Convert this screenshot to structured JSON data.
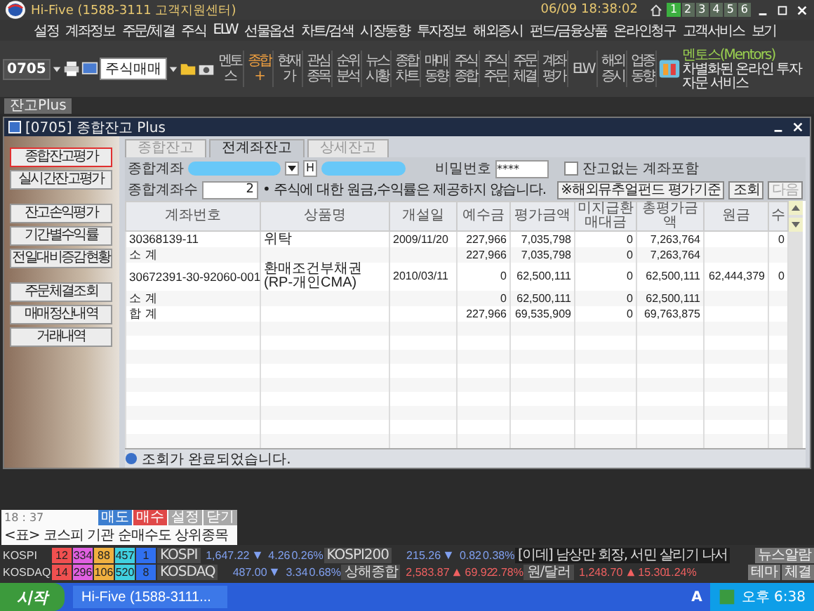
{
  "app": {
    "title": "Hi-Five (1588-3111 고객지원센터)",
    "datetime": "06/09 18:38:02",
    "screens": [
      {
        "label": "1",
        "selected": true
      },
      {
        "label": "2",
        "selected": false
      },
      {
        "label": "3",
        "selected": false
      },
      {
        "label": "4",
        "selected": false
      },
      {
        "label": "5",
        "selected": false
      },
      {
        "label": "6",
        "selected": false
      }
    ]
  },
  "menu": [
    "설정",
    "계좌정보",
    "주문/체결",
    "주식",
    "ELW",
    "선물옵션",
    "차트/검색",
    "시장동향",
    "투자정보",
    "해외증시",
    "펀드/금융상품",
    "온라인청구",
    "고객서비스",
    "보기"
  ],
  "toolbar": {
    "screen_no": "0705",
    "combo": "주식매매",
    "buttons": [
      {
        "label": "멘토스",
        "highlight": false
      },
      {
        "label": "종합+",
        "highlight": true
      },
      {
        "label": "현재가",
        "highlight": false
      },
      {
        "label": "관심종목",
        "highlight": false
      },
      {
        "label": "순위분석",
        "highlight": false
      },
      {
        "label": "뉴스시황",
        "highlight": false
      },
      {
        "label": "종합차트",
        "highlight": false
      },
      {
        "label": "매매동향",
        "highlight": false
      },
      {
        "label": "주식종합",
        "highlight": false
      },
      {
        "label": "주식주문",
        "highlight": false
      },
      {
        "label": "주문체결",
        "highlight": false
      },
      {
        "label": "계좌평가",
        "highlight": false
      },
      {
        "label": "ELW",
        "highlight": false
      },
      {
        "label": "해외증시",
        "highlight": false
      },
      {
        "label": "업종동향",
        "highlight": false
      }
    ],
    "promo": {
      "title": "멘토스(Mentors)",
      "subtitle": "차별화된 온라인 투자자문 서비스"
    }
  },
  "doc_tab": "잔고Plus",
  "window": {
    "title": "[0705] 종합잔고 Plus",
    "side_groups": [
      [
        {
          "label": "종합잔고평가",
          "selected": true
        },
        {
          "label": "실시간잔고평가",
          "selected": false
        }
      ],
      [
        {
          "label": "잔고손익평가",
          "selected": false
        },
        {
          "label": "기간별수익률",
          "selected": false
        },
        {
          "label": "전일대비증감현황",
          "selected": false
        }
      ],
      [
        {
          "label": "주문체결조회",
          "selected": false
        },
        {
          "label": "매매정산내역",
          "selected": false
        },
        {
          "label": "거래내역",
          "selected": false
        }
      ]
    ],
    "tabs": [
      {
        "label": "종합잔고",
        "selected": false
      },
      {
        "label": "전계좌잔고",
        "selected": true
      },
      {
        "label": "상세잔고",
        "selected": false
      }
    ],
    "account_label": "종합계좌",
    "account_mid": "H",
    "password_label": "비밀번호",
    "password": "****",
    "include_empty": {
      "label": "잔고없는 계좌포함",
      "checked": false
    },
    "count_label": "종합계좌수",
    "count": "2",
    "notice": "• 주식에 대한 원금,수익률은 제공하지 않습니다.",
    "fund_button": "※해외뮤추얼펀드 평가기준",
    "query_button": "조회",
    "next_button": {
      "label": "다음",
      "disabled": true
    },
    "table": {
      "columns": [
        "계좌번호",
        "상품명",
        "개설일",
        "예수금",
        "평가금액",
        "미지급환매대금",
        "총평가금액",
        "원금",
        "수"
      ],
      "rows": [
        [
          "30368139-11",
          "위탁",
          "2009/11/20",
          "227,966",
          "7,035,798",
          "0",
          "7,263,764",
          "",
          "0"
        ],
        [
          "소    계",
          "",
          "",
          "227,966",
          "7,035,798",
          "0",
          "7,263,764",
          "",
          ""
        ],
        [
          "30672391-30-92060-001",
          "환매조건부채권(RP-개인CMA)",
          "2010/03/11",
          "0",
          "62,500,111",
          "0",
          "62,500,111",
          "62,444,379",
          "0"
        ],
        [
          "소    계",
          "",
          "",
          "0",
          "62,500,111",
          "0",
          "62,500,111",
          "",
          ""
        ],
        [
          "합    계",
          "",
          "",
          "227,966",
          "69,535,909",
          "0",
          "69,763,875",
          "",
          ""
        ]
      ]
    },
    "status": "조회가 완료되었습니다."
  },
  "alert": {
    "time": "18 : 37",
    "buttons": [
      {
        "label": "매도",
        "color": "#3d7fd0"
      },
      {
        "label": "매수",
        "color": "#e04848"
      },
      {
        "label": "설정",
        "color": "#a8a8a8"
      },
      {
        "label": "닫기",
        "color": "#a8a8a8"
      }
    ],
    "text": "<표> 코스피 기관 순매수도 상위종목"
  },
  "ticker": [
    {
      "market": "KOSPI",
      "breadth": [
        {
          "value": "12",
          "color": "#f05050"
        },
        {
          "value": "334",
          "color": "#e060e0"
        },
        {
          "value": "88",
          "color": "#f0b040"
        },
        {
          "value": "457",
          "color": "#40d0e0"
        },
        {
          "value": "1",
          "color": "#3070f0"
        }
      ],
      "index": {
        "name": "KOSPI",
        "value": "1,647.22",
        "up": false,
        "change": "4.26",
        "pct": "0.26%"
      },
      "index2": {
        "name": "KOSPI200",
        "value": "215.26",
        "up": false,
        "change": "0.82",
        "pct": "0.38%"
      },
      "news": "[이데] 남상만 회장, 서민 살리기 나서",
      "buttons": [
        "뉴스알람"
      ]
    },
    {
      "market": "KOSDAQ",
      "breadth": [
        {
          "value": "14",
          "color": "#f05050"
        },
        {
          "value": "296",
          "color": "#e060e0"
        },
        {
          "value": "106",
          "color": "#f0b040"
        },
        {
          "value": "520",
          "color": "#40d0e0"
        },
        {
          "value": "8",
          "color": "#3070f0"
        }
      ],
      "index": {
        "name": "KOSDAQ",
        "value": "487.00",
        "up": false,
        "change": "3.34",
        "pct": "0.68%"
      },
      "index2": {
        "name": "상해종합",
        "value": "2,583.87",
        "up": true,
        "change": "69.92",
        "pct": "2.78%"
      },
      "fx": {
        "name": "원/달러",
        "value": "1,248.70",
        "up": true,
        "change": "15.30",
        "pct": "1.24%"
      },
      "buttons": [
        "테마",
        "체결"
      ]
    }
  ],
  "taskbar": {
    "start": "시작",
    "task": "Hi-Five (1588-3111...",
    "tray_letter": "A",
    "clock": "오후 6:38"
  }
}
